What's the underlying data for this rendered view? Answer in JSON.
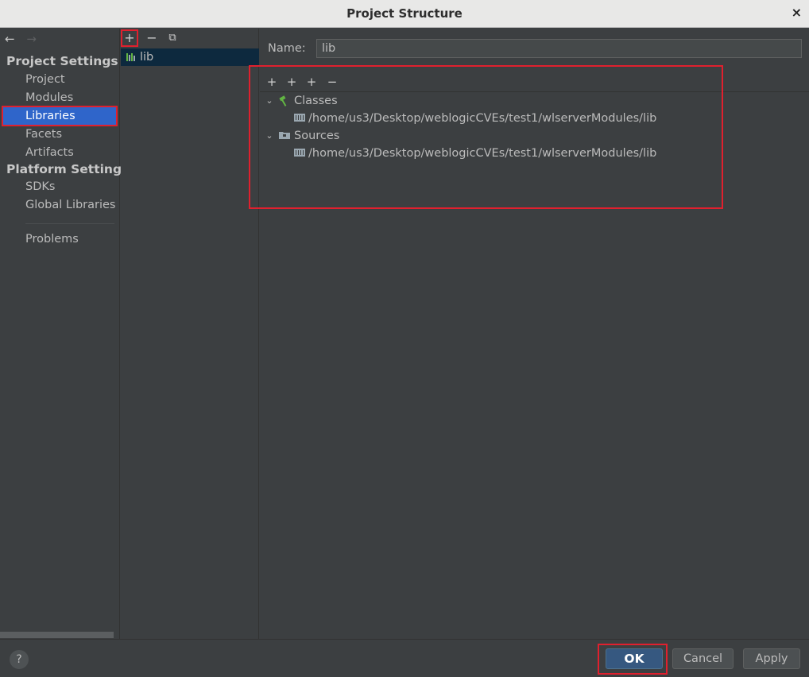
{
  "window": {
    "title": "Project Structure",
    "close_glyph": "×"
  },
  "nav": {
    "back_icon": "←",
    "forward_icon": "→",
    "project_settings_heading": "Project Settings",
    "project_settings_items": [
      "Project",
      "Modules",
      "Libraries",
      "Facets",
      "Artifacts"
    ],
    "selected_item": "Libraries",
    "platform_settings_heading": "Platform Settings",
    "platform_settings_items": [
      "SDKs",
      "Global Libraries"
    ],
    "problems": "Problems"
  },
  "libraries_panel": {
    "toolbar": {
      "add": "+",
      "remove": "−",
      "copy": "⧉"
    },
    "items": [
      "lib"
    ]
  },
  "library_detail": {
    "name_label": "Name:",
    "name_value": "lib",
    "toolbar": {
      "add": "+",
      "add_special": "+",
      "add_folder": "+",
      "remove": "−"
    },
    "roots": [
      {
        "label": "Classes",
        "icon": "hammer-icon",
        "children": [
          "/home/us3/Desktop/weblogicCVEs/test1/wlserverModules/lib"
        ]
      },
      {
        "label": "Sources",
        "icon": "folder-icon",
        "children": [
          "/home/us3/Desktop/weblogicCVEs/test1/wlserverModules/lib"
        ]
      }
    ]
  },
  "footer": {
    "help": "?",
    "ok": "OK",
    "cancel": "Cancel",
    "apply": "Apply"
  },
  "colors": {
    "accent_selection": "#2f65ca",
    "highlight_box": "#e0202e",
    "ok_button": "#365880"
  }
}
